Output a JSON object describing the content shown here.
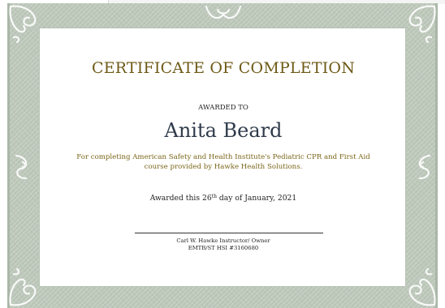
{
  "certificate": {
    "title": "CERTIFICATE OF COMPLETION",
    "awarded_to_label": "AWARDED TO",
    "recipient_name": "Anita Beard",
    "description": "For completing American Safety and Health Institute's Pediatric CPR and First Aid course provided by Hawke Health Solutions.",
    "date_prefix": "Awarded this 26",
    "date_ordinal": "th",
    "date_suffix": " day of January, 2021",
    "signer_name_title": "Carl W. Hawke Instructor/ Owner",
    "signer_credentials": "EMTB/ST HSI #3160680"
  },
  "colors": {
    "title": "#6e5a17",
    "recipient": "#2f3b4b",
    "description": "#7a6518",
    "border": "#bcc7b9"
  },
  "icons": [
    "flourish-corner-top-left-icon",
    "flourish-corner-top-right-icon",
    "flourish-corner-bottom-left-icon",
    "flourish-corner-bottom-right-icon",
    "flourish-top-center-icon",
    "flourish-side-left-icon",
    "flourish-side-right-icon"
  ]
}
